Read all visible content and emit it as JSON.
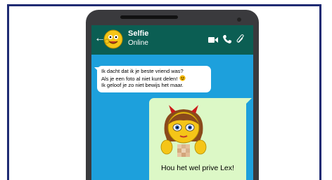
{
  "chat": {
    "contact_name": "Selfie",
    "status": "Online",
    "back_icon": "arrow-left-icon",
    "header_icons": [
      "video-camera-icon",
      "phone-icon",
      "paperclip-icon"
    ]
  },
  "messages": [
    {
      "direction": "incoming",
      "lines": [
        "Ik dacht dat ik je beste vriend was?",
        "Als je een foto al niet kunt delen!",
        "Ik geloof je zo niet bewijs het maar."
      ],
      "emoji": "smiley-emoji"
    },
    {
      "direction": "outgoing",
      "image": "censored-selfie-emoji-with-devil-horns",
      "caption": "Hou het wel prive Lex!"
    }
  ],
  "colors": {
    "frame_border": "#1f2b73",
    "header": "#0b5e53",
    "chat_background": "#1da0dc",
    "incoming_bubble": "#ffffff",
    "outgoing_bubble": "#dcf8c6"
  }
}
